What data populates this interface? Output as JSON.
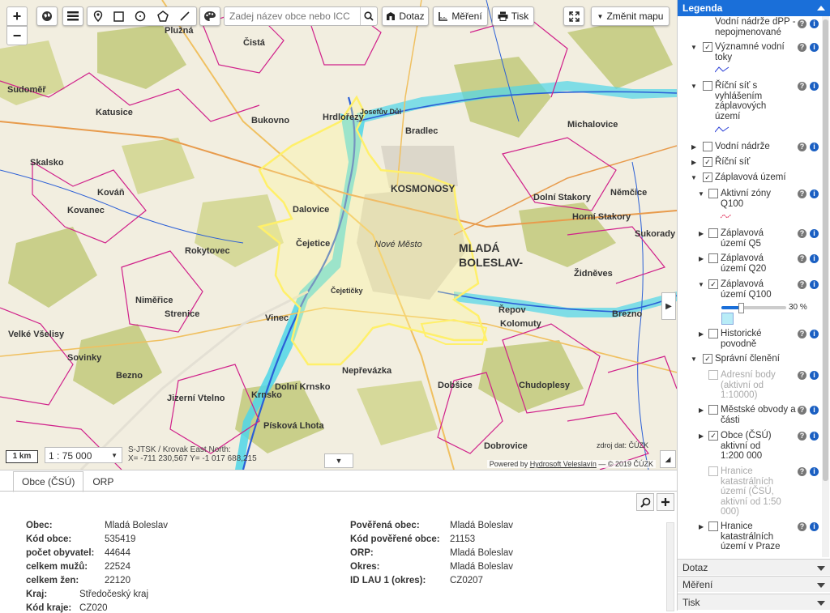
{
  "toolbar": {
    "zoom_in": "+",
    "zoom_out": "−",
    "search_placeholder": "Zadej název obce nebo ICC",
    "query_label": "Dotaz",
    "measure_label": "Měření",
    "print_label": "Tisk",
    "change_map_label": "Změnit mapu"
  },
  "map": {
    "town_labels": [
      "KOSMONOSY",
      "MLADÁ",
      "BOLESLAV-",
      "Katusice",
      "Bukovno",
      "Hrdlořezy",
      "Josefův Důl",
      "Bradlec",
      "Čistá",
      "Plužná",
      "Dalovice",
      "Skalsko",
      "Kováň",
      "Kovanec",
      "Čejetice",
      "Rokytovec",
      "Dobrovice",
      "Bezno",
      "Krnsko",
      "Písková Lhota",
      "Nepřevázka",
      "Sovinky",
      "Jizerní Vtelno",
      "Brezno",
      "Kolomuty",
      "Čejetičky",
      "Řepov",
      "Dolní Stakory",
      "Horní Stakory",
      "Sukorady",
      "Židněves",
      "Michalovice",
      "Niměřice",
      "Strenice",
      "Vinec",
      "Velké Všelisy",
      "Dolní Krnsko",
      "Němčice",
      "Chudoplesy",
      "Dobšice",
      "Sudoměř",
      "Nové Město"
    ],
    "scale_bar": "1 km",
    "scale_select": "1 : 75 000",
    "coords_line1": "S-JTSK / Krovak East North:",
    "coords_line2": "X= -711 230,567 Y= -1 017 688,215",
    "source_note": "zdroj dat: ČÚZK",
    "powered_prefix": "Powered by ",
    "powered_link": "Hydrosoft Veleslavín",
    "powered_suffix": " — © 2019 ČÚZK"
  },
  "bottom_panel": {
    "tabs": [
      "Obce (ČSÚ)",
      "ORP"
    ],
    "left_fields": [
      {
        "label": "Obec:",
        "value": "Mladá Boleslav"
      },
      {
        "label": "Kód obce:",
        "value": "535419"
      },
      {
        "label": "počet obyvatel:",
        "value": "44644"
      },
      {
        "label": "celkem mužů:",
        "value": "22524"
      },
      {
        "label": "celkem žen:",
        "value": "22120"
      },
      {
        "label": "Kraj:",
        "value": "Středočeský kraj"
      },
      {
        "label": "Kód kraje:",
        "value": "CZ020"
      }
    ],
    "right_fields": [
      {
        "label": "Pověřená obec:",
        "value": "Mladá Boleslav"
      },
      {
        "label": "Kód pověřené obce:",
        "value": "21153"
      },
      {
        "label": "ORP:",
        "value": "Mladá Boleslav"
      },
      {
        "label": "Okres:",
        "value": "Mladá Boleslav"
      },
      {
        "label": "ID LAU 1 (okres):",
        "value": "CZ0207"
      }
    ]
  },
  "legend": {
    "title": "Legenda",
    "items": [
      {
        "text": "Vodní nádrže dPP - nepojmenované"
      },
      {
        "text": "Významné vodní toky"
      },
      {
        "text": "Říční síť s vyhlášením záplavových území"
      },
      {
        "text": "Vodní nádrže"
      },
      {
        "text": "Říční síť"
      },
      {
        "text": "Záplavová území"
      },
      {
        "text": "Aktivní zóny Q100"
      },
      {
        "text": "Záplavová území Q5"
      },
      {
        "text": "Záplavová území Q20"
      },
      {
        "text": "Záplavová území Q100"
      },
      {
        "text": "Historické povodně"
      },
      {
        "text": "Správní členění"
      },
      {
        "text": "Adresní body (aktivní od 1:10000)"
      },
      {
        "text": "Městské obvody a části"
      },
      {
        "text": "Obce (ČSÚ) aktivní od 1:200 000"
      },
      {
        "text": "Hranice katastrálních území (ČSÚ, aktivní od 1:50 000)"
      },
      {
        "text": "Hranice katastrálních území v Praze"
      }
    ],
    "opacity_value": "30 %",
    "opacity_fraction": 0.3,
    "accordion": [
      "Dotaz",
      "Měření",
      "Tisk"
    ]
  },
  "colors": {
    "accent": "#1a6fd9",
    "water": "#4fd6e8",
    "forest": "#c9cf8a",
    "boundary": "#d0208a",
    "highlight": "#fff06a"
  }
}
